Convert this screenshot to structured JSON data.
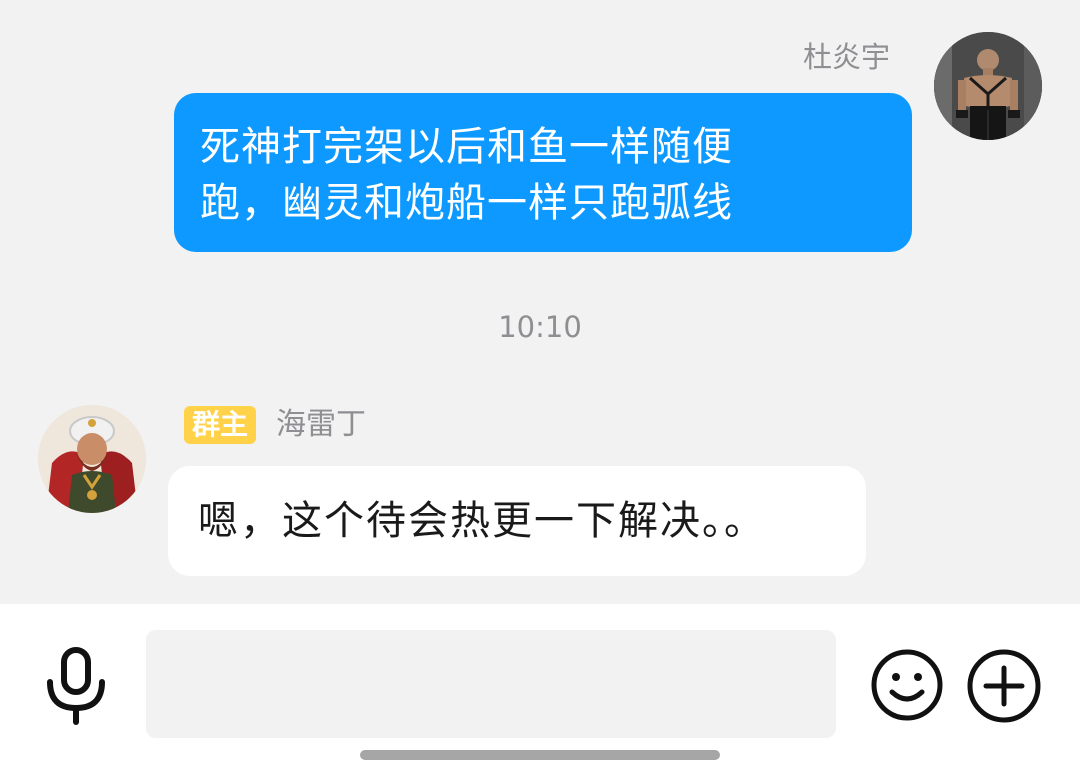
{
  "messages": {
    "outgoing": {
      "sender": "杜炎宇",
      "line1": "死神打完架以后和鱼一样随便",
      "line2": "跑，幽灵和炮船一样只跑弧线",
      "bubble_color": "#0d99ff"
    },
    "timestamp": "10:10",
    "incoming": {
      "role_badge": "群主",
      "sender": "海雷丁",
      "text": "嗯，这个待会热更一下解决。。",
      "badge_color": "#ffd24a"
    }
  },
  "input_bar": {
    "placeholder": "",
    "mic_icon": "microphone-icon",
    "emoji_icon": "smiley-face-icon",
    "plus_icon": "plus-circle-icon"
  }
}
